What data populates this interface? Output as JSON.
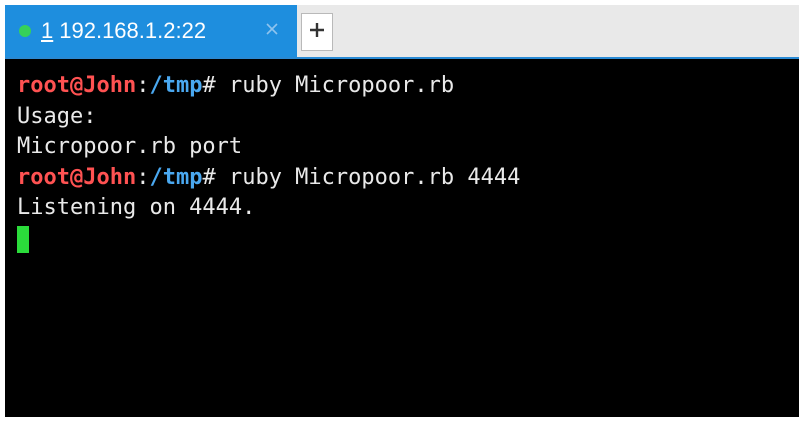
{
  "colors": {
    "tab_active": "#1e8ede",
    "status_dot": "#36d15a",
    "prompt_user": "#ff5252",
    "prompt_path": "#4aa8f0",
    "cursor": "#2bdc3b",
    "terminal_bg": "#000000",
    "terminal_fg": "#e9e9e9"
  },
  "tabs": [
    {
      "number": "1",
      "title": "192.168.1.2:22",
      "status_icon": "connected-dot-icon",
      "close_icon": "close-icon"
    }
  ],
  "new_tab": {
    "icon": "plus-icon"
  },
  "terminal": {
    "lines": [
      {
        "type": "prompt",
        "user": "root@John",
        "separator": ":",
        "path": "/tmp",
        "hash": "# ",
        "command": "ruby Micropoor.rb"
      },
      {
        "type": "output",
        "text": "Usage:"
      },
      {
        "type": "output",
        "text": "Micropoor.rb port"
      },
      {
        "type": "prompt",
        "user": "root@John",
        "separator": ":",
        "path": "/tmp",
        "hash": "# ",
        "command": "ruby Micropoor.rb 4444"
      },
      {
        "type": "output",
        "text": "Listening on 4444."
      }
    ]
  }
}
